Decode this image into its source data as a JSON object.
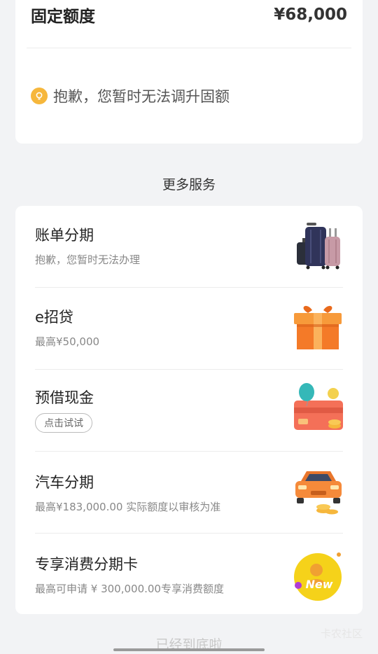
{
  "quota": {
    "label": "固定额度",
    "value": "¥68,000",
    "notice": "抱歉，您暂时无法调升固额"
  },
  "section_title": "更多服务",
  "services": [
    {
      "title": "账单分期",
      "subtitle": "抱歉，您暂时无法办理",
      "icon": "luggage-icon"
    },
    {
      "title": "e招贷",
      "subtitle": "最高¥50,000",
      "icon": "gift-box-icon"
    },
    {
      "title": "预借现金",
      "pill": "点击试试",
      "icon": "balloon-card-icon"
    },
    {
      "title": "汽车分期",
      "subtitle": "最高¥183,000.00 实际额度以审核为准",
      "icon": "car-icon"
    },
    {
      "title": "专享消费分期卡",
      "subtitle": "最高可申请 ¥ 300,000.00专享消费额度",
      "icon": "new-card-icon"
    }
  ],
  "footer": "已经到底啦",
  "watermark": "卡农社区",
  "colors": {
    "accent": "#f6b73c",
    "orange": "#f47a28"
  }
}
